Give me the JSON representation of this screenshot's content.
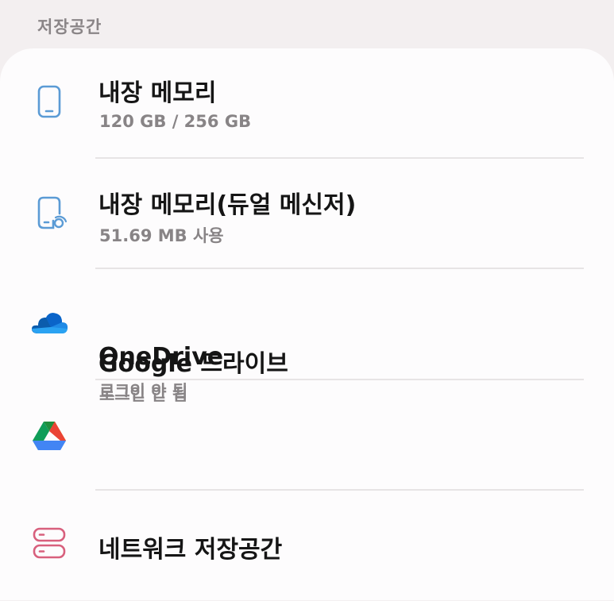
{
  "section": {
    "title": "저장공간"
  },
  "items": [
    {
      "title": "내장 메모리",
      "subtitle": "120 GB / 256 GB",
      "icon": "phone-icon"
    },
    {
      "title": "내장 메모리(듀얼 메신저)",
      "subtitle": "51.69 MB 사용",
      "icon": "dual-messenger-phone-icon"
    },
    {
      "title": "OneDrive",
      "subtitle": "로그인 안 됨",
      "icon": "onedrive-cloud-icon"
    },
    {
      "title": "Google 드라이브",
      "subtitle": "로그인 안 됨",
      "icon": "google-drive-icon"
    },
    {
      "title": "네트워크 저장공간",
      "icon": "network-storage-icon"
    }
  ],
  "colors": {
    "background": "#f3eff0",
    "card": "#fdfcfd",
    "phone_icon": "#5b9bd5",
    "onedrive": "#0a64c9",
    "network_icon": "#d8607d"
  }
}
